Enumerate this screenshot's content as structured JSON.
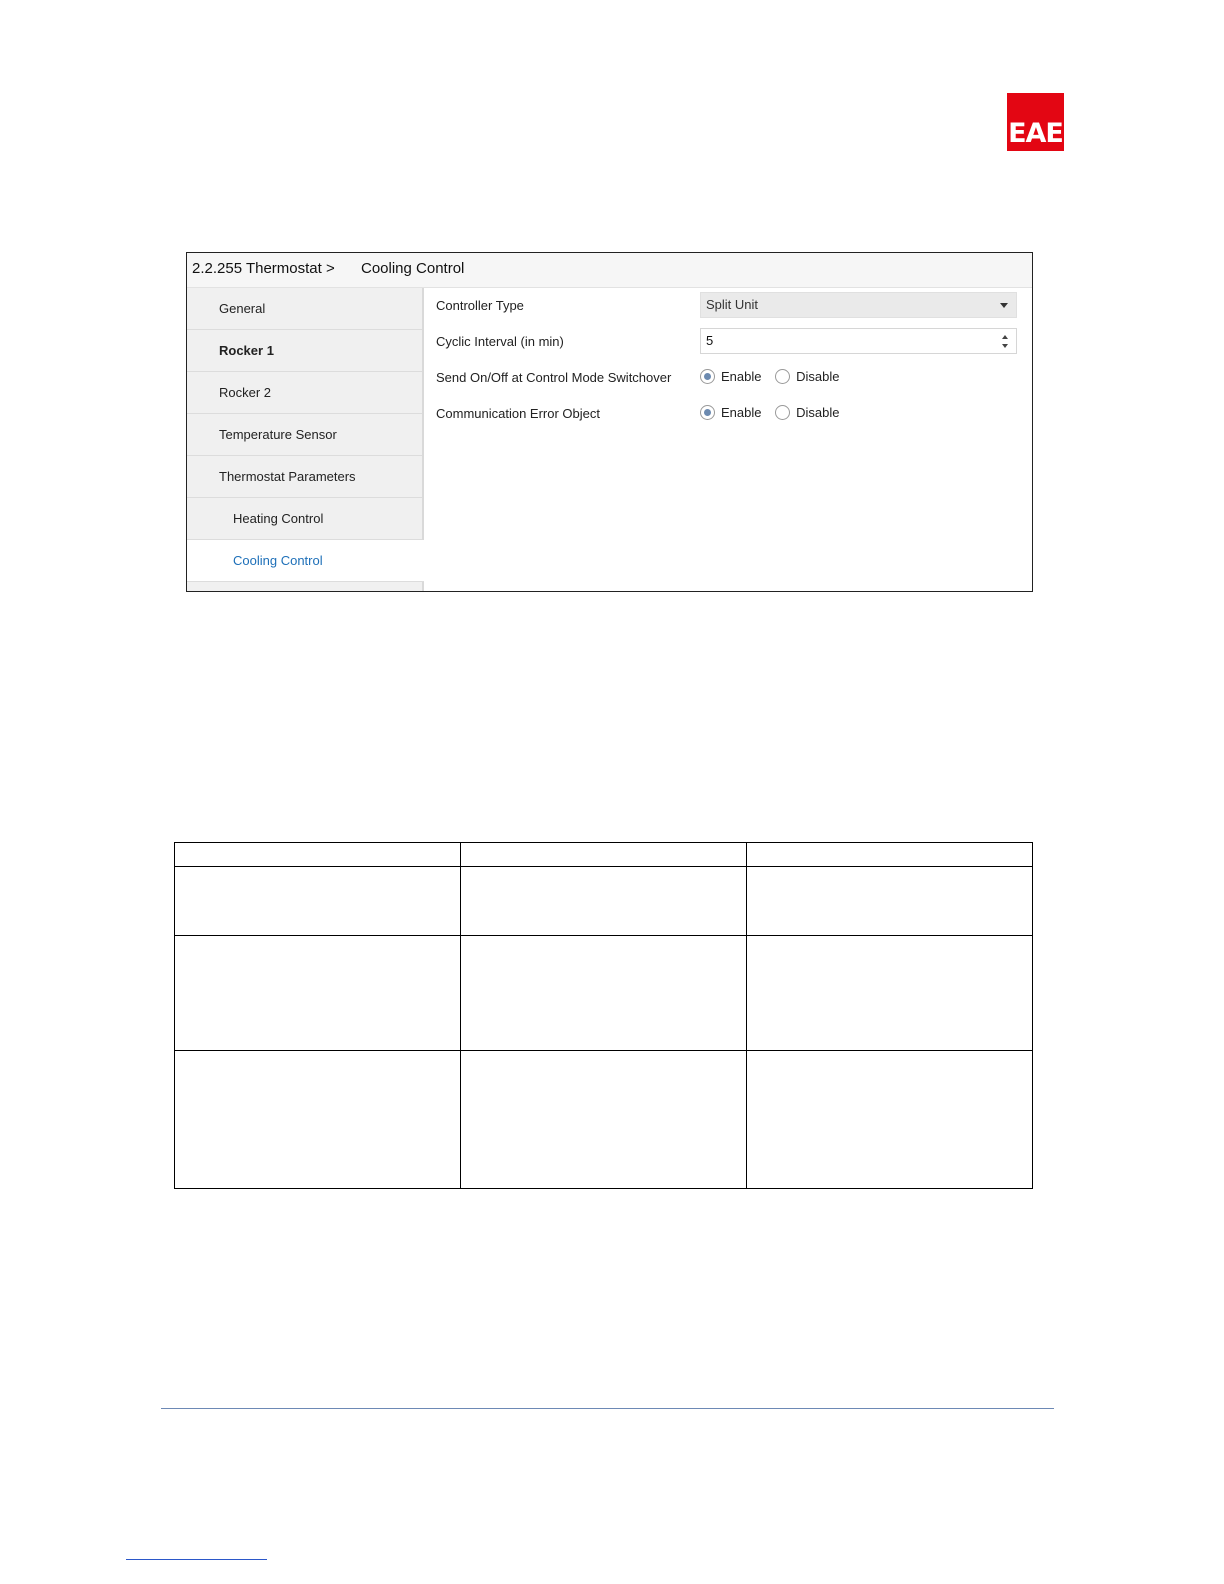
{
  "brand": {
    "logo_text": "EAE",
    "color": "#e30613"
  },
  "panel": {
    "device": "2.2.255 Thermostat >",
    "section": "Cooling Control",
    "nav": [
      {
        "label": "General"
      },
      {
        "label": "Rocker 1"
      },
      {
        "label": "Rocker 2"
      },
      {
        "label": "Temperature Sensor"
      },
      {
        "label": "Thermostat Parameters"
      },
      {
        "label": "Heating Control"
      },
      {
        "label": "Cooling Control"
      }
    ],
    "params": {
      "controller_type": {
        "label": "Controller Type",
        "value": "Split Unit"
      },
      "cyclic_interval": {
        "label": "Cyclic Interval (in min)",
        "value": "5"
      },
      "send_onoff": {
        "label": "Send On/Off at Control Mode Switchover",
        "enable": "Enable",
        "disable": "Disable",
        "selected": "Enable"
      },
      "comm_error": {
        "label": "Communication Error Object",
        "enable": "Enable",
        "disable": "Disable",
        "selected": "Enable"
      }
    },
    "accent_color": "#1d6fb8"
  },
  "table": {
    "columns": 3,
    "rows": 4
  }
}
